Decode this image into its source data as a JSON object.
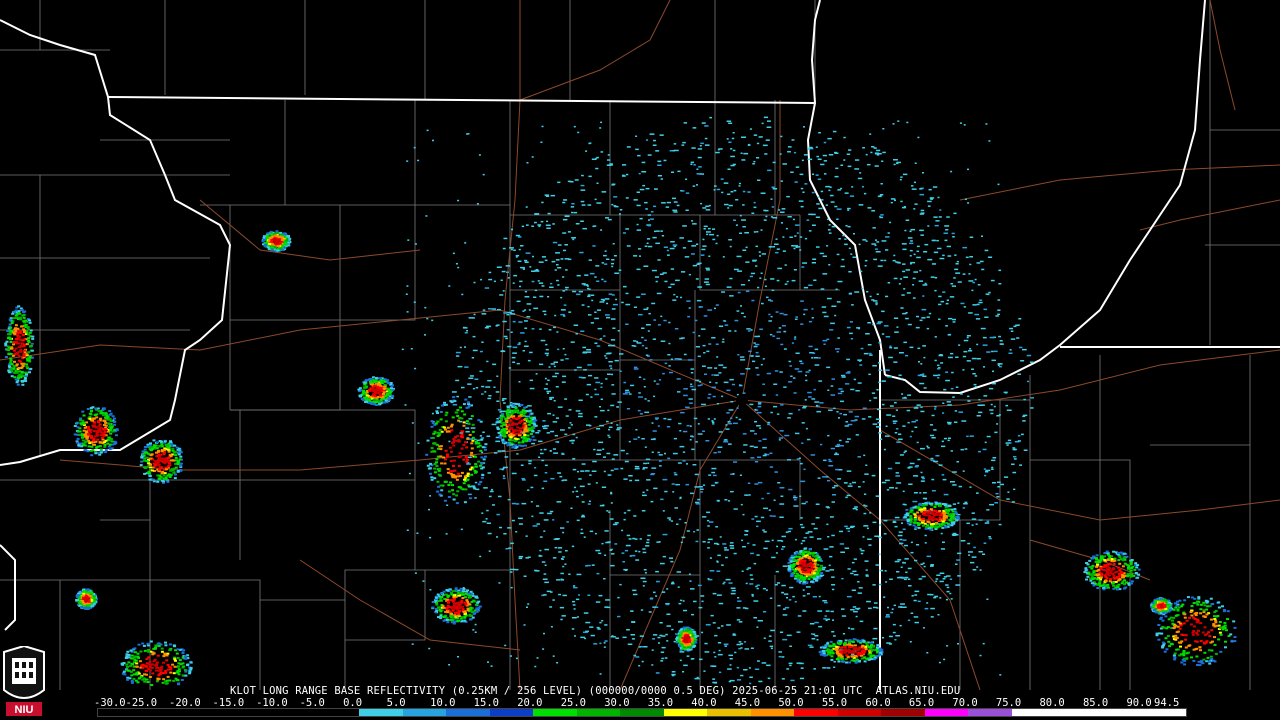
{
  "product": {
    "caption": "KLOT LONG RANGE BASE REFLECTIVITY (0.25KM / 256 LEVEL) (000000/0000 0.5 DEG) 2025-06-25 21:01 UTC  ATLAS.NIU.EDU",
    "radar_site": "KLOT",
    "source": "ATLAS.NIU.EDU"
  },
  "legend": {
    "labels": [
      "-30.0",
      "-25.0",
      "-20.0",
      "-15.0",
      "-10.0",
      "-5.0",
      "0.0",
      "5.0",
      "10.0",
      "15.0",
      "20.0",
      "25.0",
      "30.0",
      "35.0",
      "40.0",
      "45.0",
      "50.0",
      "55.0",
      "60.0",
      "65.0",
      "70.0",
      "75.0",
      "80.0",
      "85.0",
      "90.0",
      "94.5"
    ],
    "colors": [
      "#000000",
      "#000000",
      "#000000",
      "#000000",
      "#000000",
      "#000000",
      "#3fd0e8",
      "#26a4e0",
      "#1a6fd8",
      "#0d3ec8",
      "#00e000",
      "#00b400",
      "#008a00",
      "#ffff00",
      "#e8c000",
      "#ff9000",
      "#ff0000",
      "#d00000",
      "#a00000",
      "#ff00ff",
      "#9a50d8",
      "#ffffff",
      "#ffffff",
      "#ffffff",
      "#ffffff"
    ]
  },
  "logo": {
    "text": "NIU",
    "color": "#c8102e"
  },
  "map_colors": {
    "background": "#000000",
    "state_lines": "#ffffff",
    "county_lines": "#8a8a8a",
    "roads": "#8b4a2a",
    "radar_center": "#000000"
  }
}
